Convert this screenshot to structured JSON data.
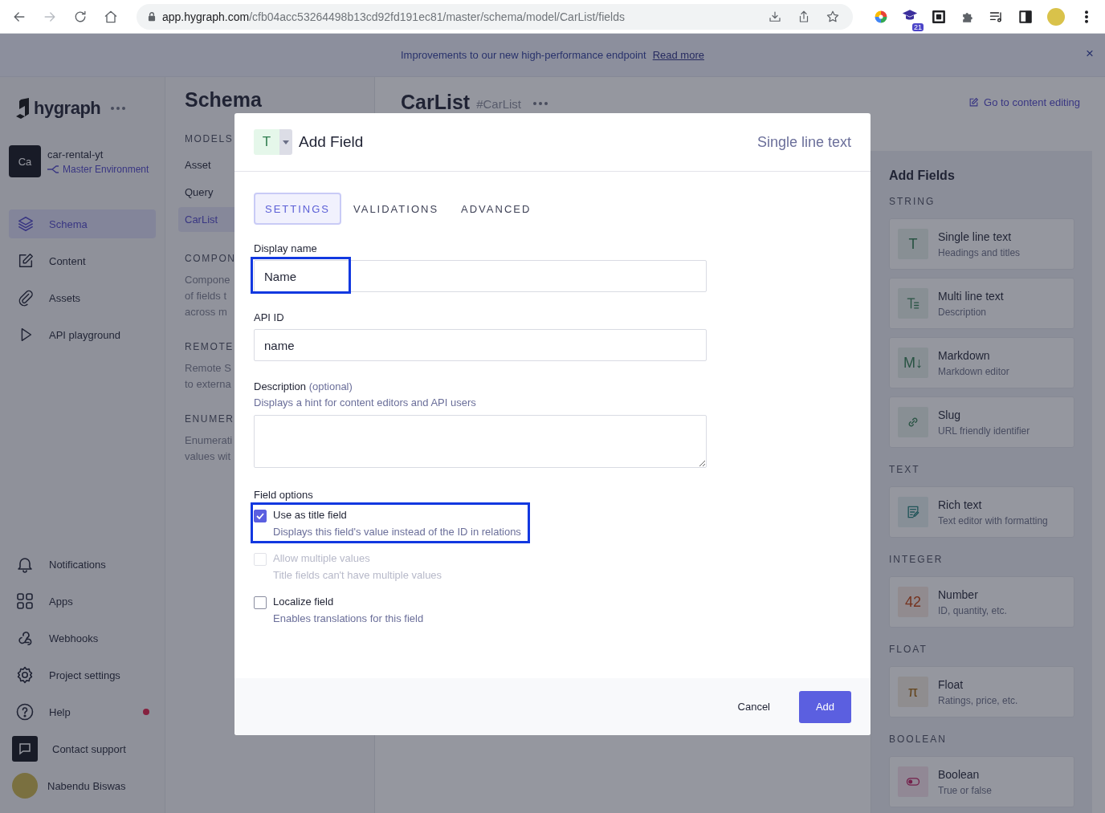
{
  "browser": {
    "url_host": "app.hygraph.com",
    "url_path": "/cfb04acc53264498b13cd92fd191ec81/master/schema/model/CarList/fields",
    "extension_badge": "21"
  },
  "banner": {
    "message": "Improvements to our new high-performance endpoint",
    "link": "Read more",
    "close": "×"
  },
  "sidebar": {
    "logo": "hygraph",
    "project": {
      "avatar": "Ca",
      "name": "car-rental-yt",
      "environment": "Master Environment"
    },
    "nav": [
      {
        "label": "Schema",
        "kind": "layers",
        "selected": true
      },
      {
        "label": "Content",
        "kind": "edit",
        "selected": false
      },
      {
        "label": "Assets",
        "kind": "clip",
        "selected": false
      },
      {
        "label": "API playground",
        "kind": "play",
        "selected": false
      }
    ],
    "bottom": [
      {
        "label": "Notifications",
        "kind": "bell",
        "dot": false
      },
      {
        "label": "Apps",
        "kind": "grid",
        "dot": false
      },
      {
        "label": "Webhooks",
        "kind": "webhook",
        "dot": false
      },
      {
        "label": "Project settings",
        "kind": "gear",
        "dot": false
      },
      {
        "label": "Help",
        "kind": "help",
        "dot": true
      },
      {
        "label": "Contact support",
        "kind": "chat",
        "dot": false
      }
    ],
    "user": {
      "name": "Nabendu Biswas"
    }
  },
  "schema_panel": {
    "title": "Schema",
    "sections": [
      {
        "heading": "MODELS",
        "items": [
          {
            "label": "Asset",
            "selected": false
          },
          {
            "label": "Query",
            "selected": false
          },
          {
            "label": "CarList",
            "selected": true
          }
        ]
      },
      {
        "heading": "COMPON",
        "lines": [
          "Compone",
          "of fields t",
          "across m"
        ]
      },
      {
        "heading": "REMOTE",
        "lines": [
          "Remote S",
          "to externa"
        ]
      },
      {
        "heading": "ENUMER",
        "lines": [
          "Enumerati",
          "values wit"
        ]
      }
    ]
  },
  "model_header": {
    "title": "CarList",
    "api_id": "#CarList",
    "link": "Go to content editing"
  },
  "add_fields": {
    "title": "Add Fields",
    "groups": [
      {
        "heading": "STRING",
        "items": [
          {
            "title": "Single line text",
            "subtitle": "Headings and titles",
            "kind": "text",
            "glyph": "T"
          },
          {
            "title": "Multi line text",
            "subtitle": "Description",
            "kind": "lines"
          },
          {
            "title": "Markdown",
            "subtitle": "Markdown editor",
            "kind": "markdown",
            "glyph": "M↓"
          },
          {
            "title": "Slug",
            "subtitle": "URL friendly identifier",
            "kind": "link"
          }
        ]
      },
      {
        "heading": "TEXT",
        "items": [
          {
            "title": "Rich text",
            "subtitle": "Text editor with formatting",
            "kind": "doc"
          }
        ]
      },
      {
        "heading": "INTEGER",
        "items": [
          {
            "title": "Number",
            "subtitle": "ID, quantity, etc.",
            "kind": "number",
            "glyph": "42"
          }
        ]
      },
      {
        "heading": "FLOAT",
        "items": [
          {
            "title": "Float",
            "subtitle": "Ratings, price, etc.",
            "kind": "float",
            "glyph": "π"
          }
        ]
      },
      {
        "heading": "BOOLEAN",
        "items": [
          {
            "title": "Boolean",
            "subtitle": "True or false",
            "kind": "toggle"
          }
        ]
      }
    ]
  },
  "modal": {
    "type_glyph": "T",
    "title": "Add Field",
    "type_label": "Single line text",
    "tabs": [
      {
        "label": "SETTINGS",
        "selected": true
      },
      {
        "label": "VALIDATIONS",
        "selected": false
      },
      {
        "label": "ADVANCED",
        "selected": false
      }
    ],
    "display_name": {
      "label": "Display name",
      "value": "Name",
      "highlighted": true
    },
    "api_id": {
      "label": "API ID",
      "value": "name"
    },
    "description": {
      "label": "Description",
      "optional": "(optional)",
      "hint": "Displays a hint for content editors and API users"
    },
    "field_options": {
      "label": "Field options",
      "options": [
        {
          "label": "Use as title field",
          "hint": "Displays this field's value instead of the ID in relations",
          "checked": true,
          "disabled": false,
          "highlighted": true
        },
        {
          "label": "Allow multiple values",
          "hint": "Title fields can't have multiple values",
          "checked": false,
          "disabled": true,
          "highlighted": false
        },
        {
          "label": "Localize field",
          "hint": "Enables translations for this field",
          "checked": false,
          "disabled": false,
          "highlighted": false
        }
      ]
    },
    "buttons": {
      "cancel": "Cancel",
      "submit": "Add"
    }
  }
}
